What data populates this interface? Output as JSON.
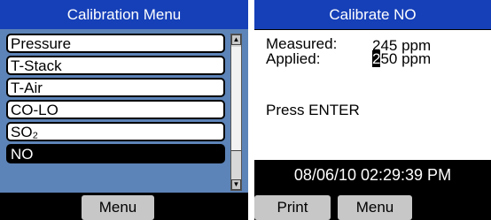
{
  "left_screen": {
    "title": "Calibration Menu",
    "items": [
      {
        "label": "Pressure",
        "selected": false
      },
      {
        "label": "T-Stack",
        "selected": false
      },
      {
        "label": "T-Air",
        "selected": false
      },
      {
        "label": "CO-LO",
        "selected": false
      },
      {
        "label": "SO₂",
        "selected": false
      },
      {
        "label": "NO",
        "selected": true
      }
    ],
    "scroll_up_icon": "triangle-up-icon",
    "scroll_down_icon": "triangle-down-icon",
    "softkeys": [
      {
        "label": "Menu"
      }
    ],
    "colors": {
      "title_bg": "#1640b8",
      "list_bg": "#5d84b8",
      "softkey_bg": "#c7c7c7"
    }
  },
  "right_screen": {
    "title": "Calibrate NO",
    "measured_label": "Measured:",
    "measured_value": "245 ppm",
    "applied_label": "Applied:",
    "applied_cursor_digit": "2",
    "applied_value_rest": "50 ppm",
    "prompt": "Press ENTER",
    "datetime": "08/06/10 02:29:39 PM",
    "softkeys": [
      {
        "label": "Print"
      },
      {
        "label": "Menu"
      }
    ]
  }
}
